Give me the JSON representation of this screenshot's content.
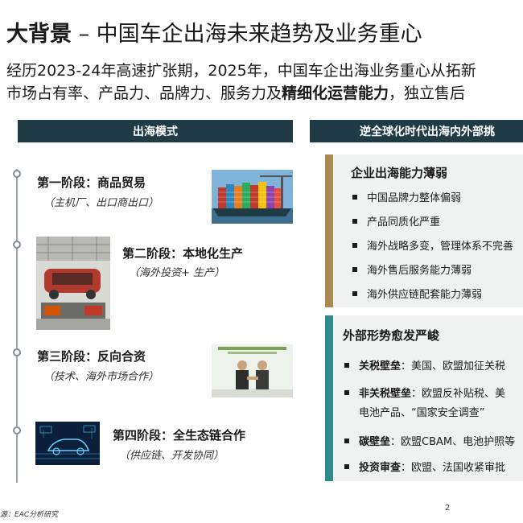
{
  "title": {
    "bold": "大背景",
    "rest": " – 中国车企出海未来趋势及业务重心"
  },
  "intro": {
    "line1": "经历2023-24年高速扩张期，2025年，中国车企出海业务重心从拓新",
    "line2_pre": "市场占有率、产品力、品牌力、服务力及",
    "line2_bold": "精细化运营能力",
    "line2_post": "，独立售后"
  },
  "left_header": "出海模式",
  "right_header": "逆全球化时代出海内外部挑",
  "stages": [
    {
      "title": "第一阶段：商品贸易",
      "sub": "（主机厂、出口商出口）"
    },
    {
      "title": "第二阶段：本地化生产",
      "sub": "（海外投资+ 生产）"
    },
    {
      "title": "第三阶段：反向合资",
      "sub": "（技术、海外市场合作）"
    },
    {
      "title": "第四阶段：全生态链合作",
      "sub": "（供应链、开发协同）"
    }
  ],
  "internal_box": {
    "title": "企业出海能力薄弱",
    "items": [
      "中国品牌力整体偏弱",
      "产品同质化严重",
      "海外战略多变，管理体系不完善",
      "海外售后服务能力薄弱",
      "海外供应链配套能力薄弱"
    ]
  },
  "external_box": {
    "title": "外部形势愈发严峻",
    "items": [
      {
        "key": "关税壁垒",
        "text": "：美国、欧盟加征关税"
      },
      {
        "key": "非关税壁垒",
        "text": "：欧盟反补贴税、美",
        "cont": "电池产品、“国家安全调查”"
      },
      {
        "key": "碳壁垒",
        "text": "：欧盟CBAM、电池护照等"
      },
      {
        "key": "投资审查",
        "text": "：欧盟、法国收紧审批"
      }
    ]
  },
  "footer": {
    "source": "源：EAC分析研究",
    "page": "2"
  },
  "colors": {
    "header_bg": "#1f3b45",
    "brown_accent": "#a88a52",
    "teal_accent": "#2f8a8a"
  }
}
